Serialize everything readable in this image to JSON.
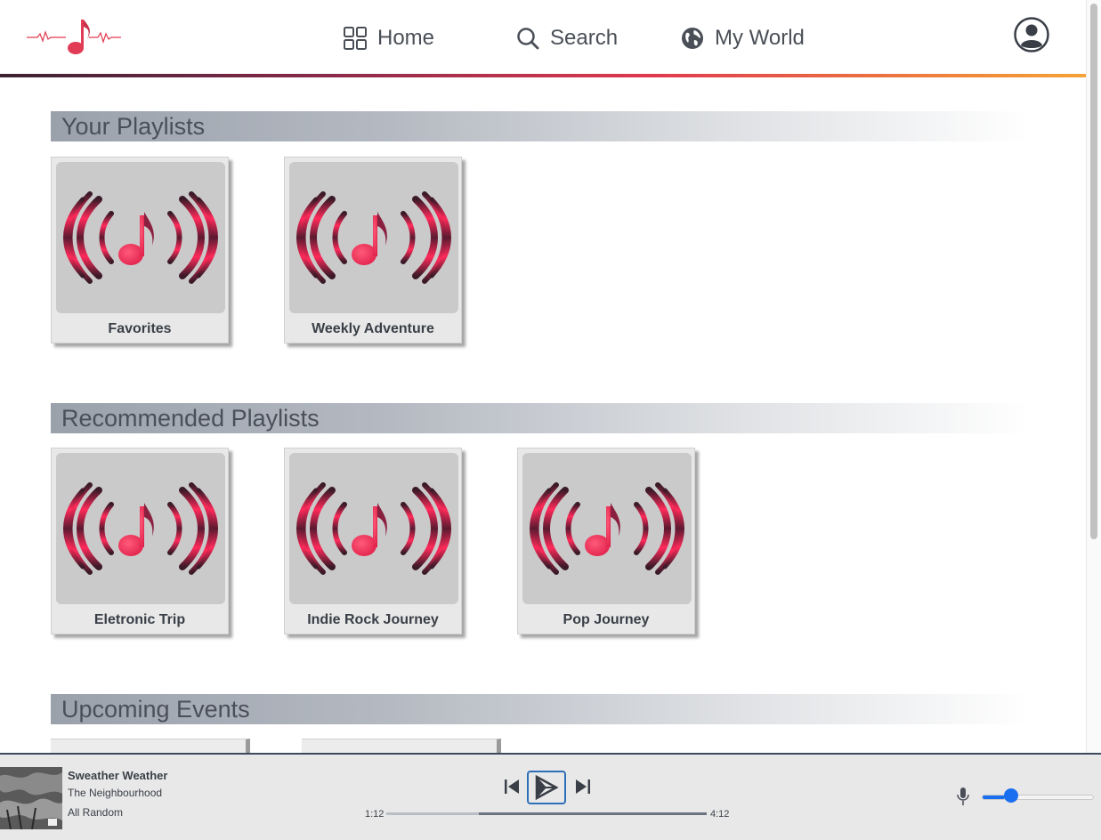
{
  "nav": {
    "home_label": "Home",
    "search_label": "Search",
    "world_label": "My World"
  },
  "sections": {
    "your_playlists": {
      "title": "Your Playlists",
      "items": [
        {
          "label": "Favorites"
        },
        {
          "label": "Weekly Adventure"
        }
      ]
    },
    "recommended": {
      "title": "Recommended Playlists",
      "items": [
        {
          "label": "Eletronic Trip"
        },
        {
          "label": "Indie Rock Journey"
        },
        {
          "label": "Pop Journey"
        }
      ]
    },
    "events": {
      "title": "Upcoming Events"
    }
  },
  "player": {
    "track_title": "Sweather Weather",
    "artist": "The Neighbourhood",
    "mode": "All Random",
    "time_current": "1:12",
    "time_total": "4:12",
    "progress_fraction": 0.29,
    "volume_fraction": 0.2
  },
  "colors": {
    "accent_pink": "#e8335a",
    "volume_blue": "#1a6ff0",
    "play_border": "#2f6fb8"
  }
}
